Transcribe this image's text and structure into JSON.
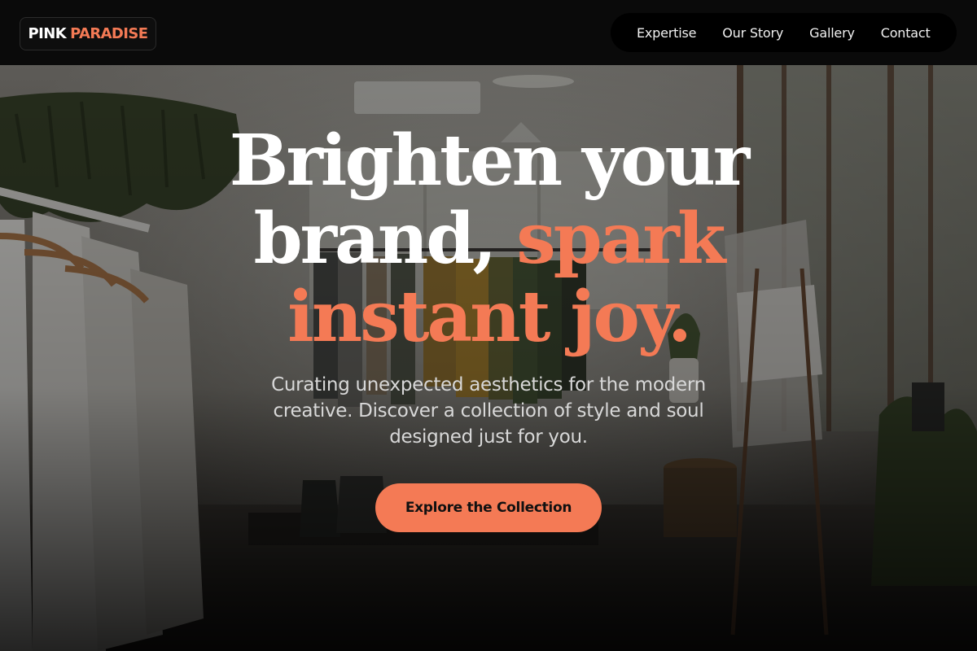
{
  "brand": {
    "word1": "PINK",
    "word2": "PARADISE"
  },
  "nav": {
    "items": [
      {
        "label": "Expertise"
      },
      {
        "label": "Our Story"
      },
      {
        "label": "Gallery"
      },
      {
        "label": "Contact"
      }
    ]
  },
  "hero": {
    "headline_line1": "Brighten your",
    "headline_line2_plain": "brand, ",
    "headline_line2_accent": "spark",
    "headline_line3_accent": "instant joy.",
    "subtitle": "Curating unexpected aesthetics for the modern creative. Discover a collection of style and soul designed just for you.",
    "cta_label": "Explore the Collection"
  },
  "colors": {
    "accent": "#f47a55",
    "header_bg": "#0a0a0a",
    "nav_pill_bg": "#000000",
    "text_light": "#ffffff"
  }
}
